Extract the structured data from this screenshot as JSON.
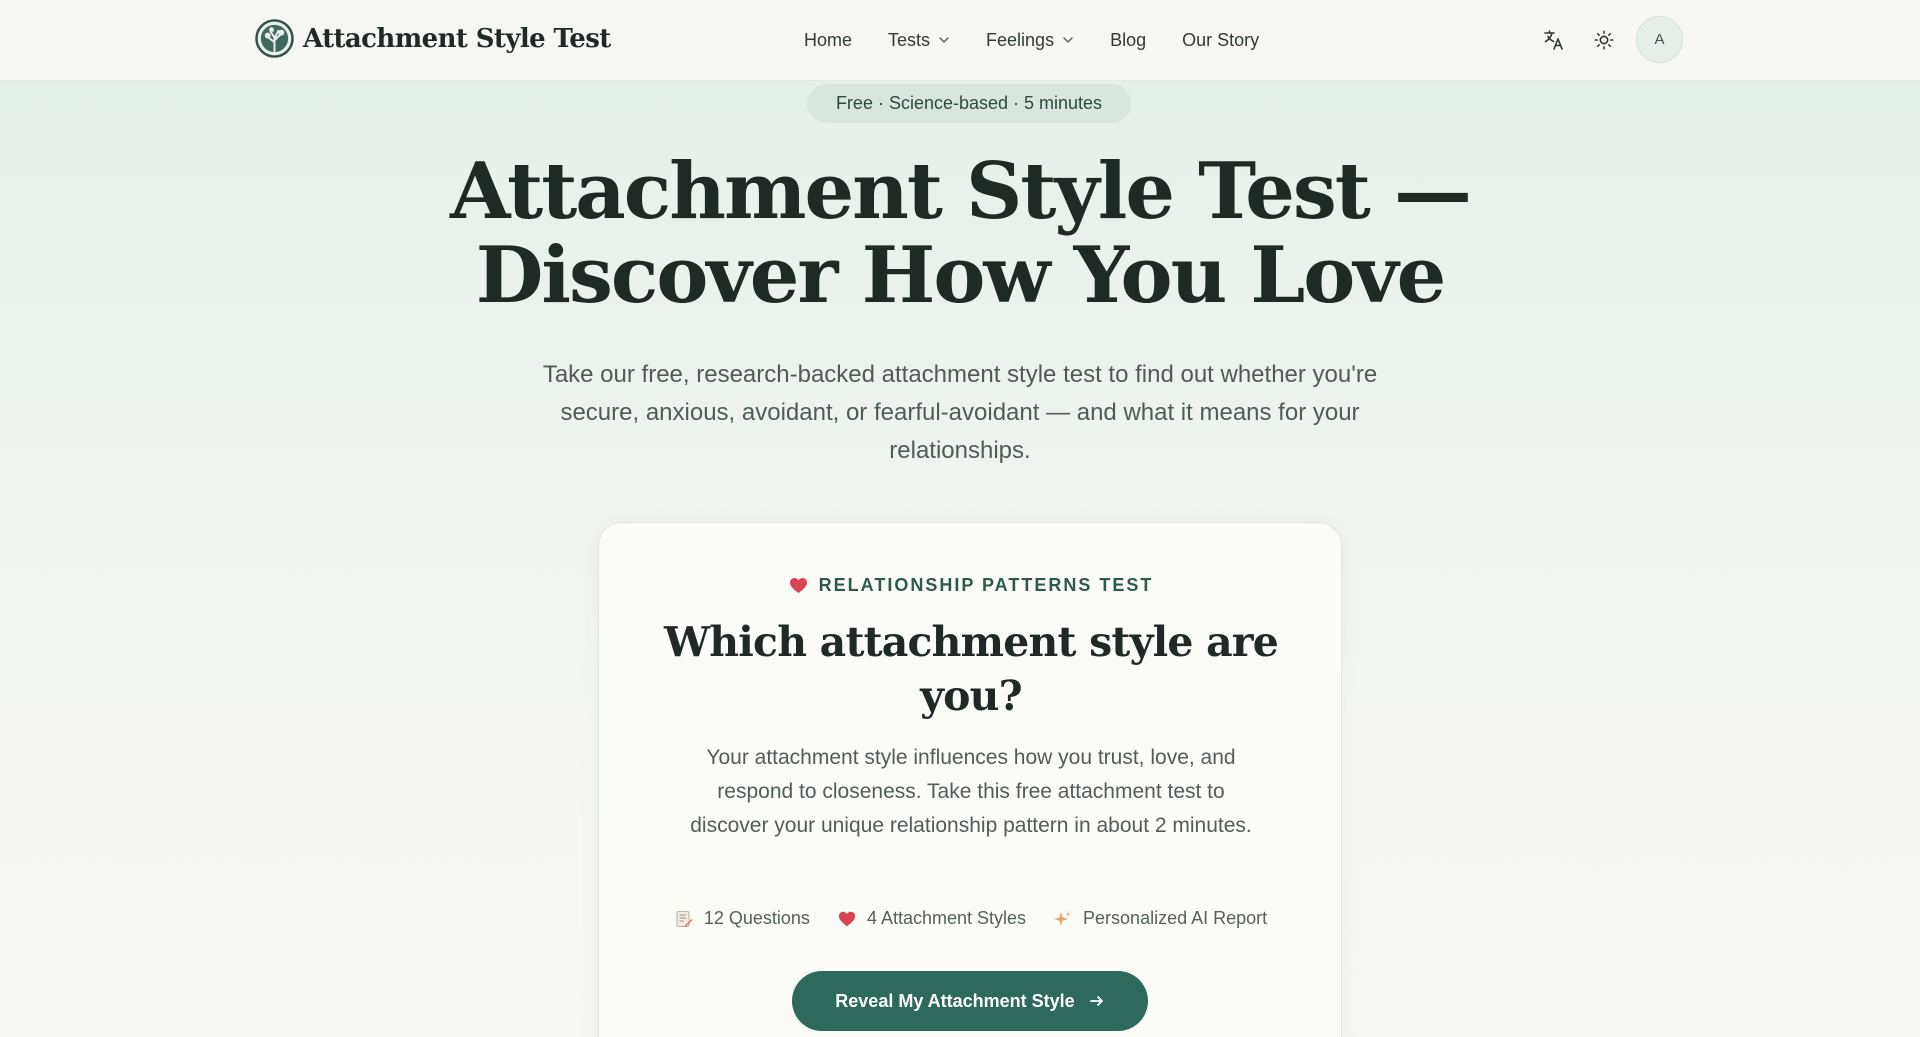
{
  "header": {
    "brand": "Attachment Style Test",
    "nav": [
      {
        "label": "Home",
        "has_dropdown": false
      },
      {
        "label": "Tests",
        "has_dropdown": true
      },
      {
        "label": "Feelings",
        "has_dropdown": true
      },
      {
        "label": "Blog",
        "has_dropdown": false
      },
      {
        "label": "Our Story",
        "has_dropdown": false
      }
    ],
    "translate_icon": "translate-icon",
    "theme_icon": "sun-icon",
    "avatar_initial": "A"
  },
  "hero": {
    "pill": "Free · Science-based · 5 minutes",
    "title_line1": "Attachment Style Test —",
    "title_line2": "Discover How You Love",
    "subtitle": "Take our free, research-backed attachment style test to find out whether you're secure, anxious, avoidant, or fearful-avoidant — and what it means for your relationships."
  },
  "card": {
    "eyebrow": "RELATIONSHIP PATTERNS TEST",
    "eyebrow_icon": "heart-icon",
    "title": "Which attachment style are you?",
    "description": "Your attachment style influences how you trust, love, and respond to closeness. Take this free attachment test to discover your unique relationship pattern in about 2 minutes.",
    "features": [
      {
        "icon": "memo-icon",
        "label": "12 Questions"
      },
      {
        "icon": "heart-icon",
        "label": "4 Attachment Styles"
      },
      {
        "icon": "sparkles-icon",
        "label": "Personalized AI Report"
      }
    ],
    "cta": "Reveal My Attachment Style"
  },
  "colors": {
    "accent": "#2d6a5b",
    "heart": "#d94356",
    "text": "#1f2a26",
    "pill_bg": "#d9e6df"
  }
}
